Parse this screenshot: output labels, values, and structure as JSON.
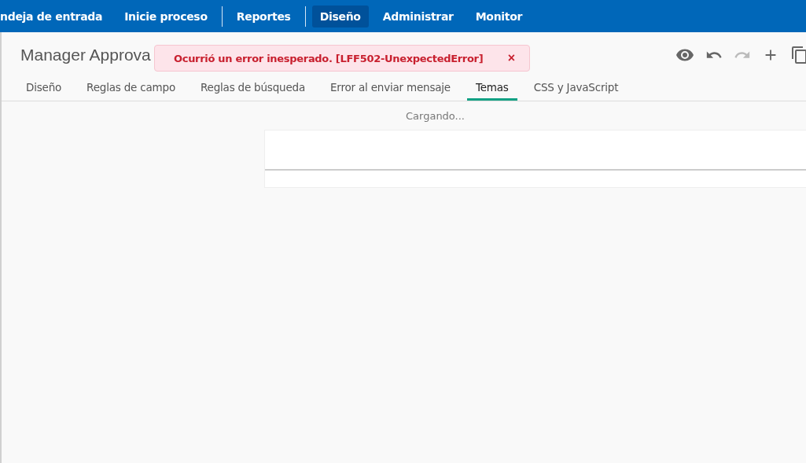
{
  "nav": [
    {
      "label": "ndeja de entrada",
      "selected": false,
      "divider_after": false
    },
    {
      "label": "Inicie proceso",
      "selected": false,
      "divider_after": true
    },
    {
      "label": "Reportes",
      "selected": false,
      "divider_after": true
    },
    {
      "label": "Diseño",
      "selected": true,
      "divider_after": false
    },
    {
      "label": "Administrar",
      "selected": false,
      "divider_after": false
    },
    {
      "label": "Monitor",
      "selected": false,
      "divider_after": false
    }
  ],
  "page_title": "Manager Approva",
  "toast": {
    "message": "Ocurrió un error inesperado. [LFF502-UnexpectedError]",
    "close": "×"
  },
  "toolbar": [
    {
      "kind": "preview",
      "disabled": false
    },
    {
      "kind": "undo",
      "disabled": false
    },
    {
      "kind": "redo",
      "disabled": true
    },
    {
      "kind": "add",
      "disabled": false
    },
    {
      "kind": "copy",
      "disabled": false
    }
  ],
  "tabs": [
    {
      "label": "Diseño",
      "selected": false
    },
    {
      "label": "Reglas de campo",
      "selected": false
    },
    {
      "label": "Reglas de búsqueda",
      "selected": false
    },
    {
      "label": "Error al enviar mensaje",
      "selected": false
    },
    {
      "label": "Temas",
      "selected": true
    },
    {
      "label": "CSS y JavaScript",
      "selected": false
    }
  ],
  "status": "Cargando..."
}
